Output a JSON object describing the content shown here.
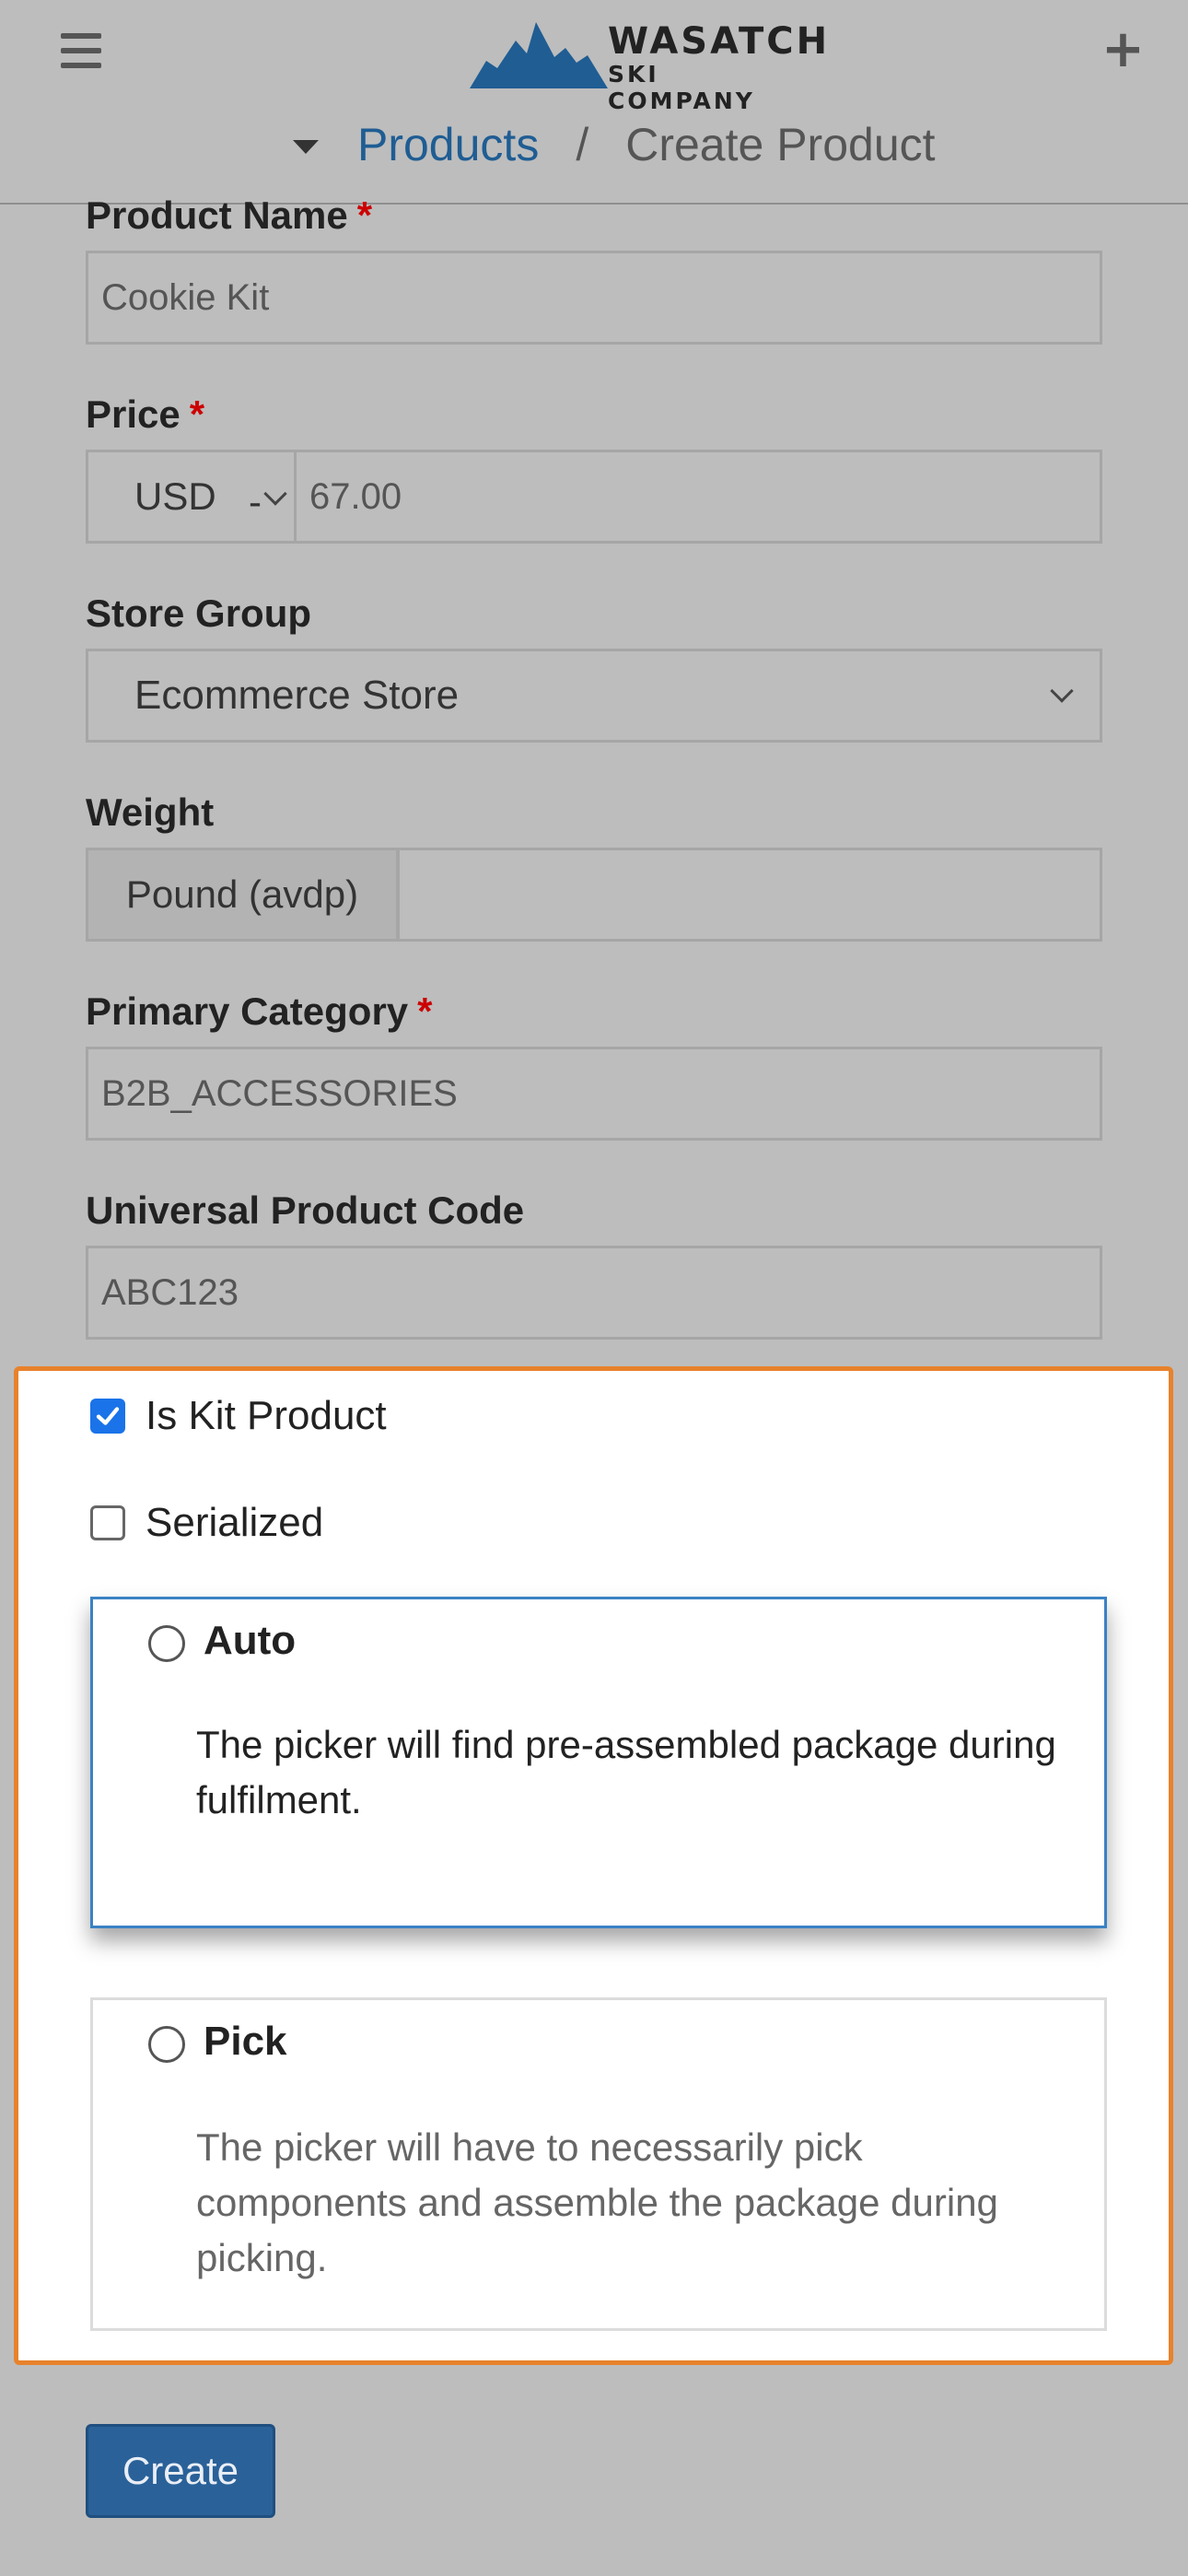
{
  "header": {
    "logo": {
      "line1": "WASATCH",
      "line2": "SKI COMPANY",
      "icon": "mountain-logo-icon"
    },
    "menu_icon": "hamburger-icon",
    "add_icon": "plus-icon",
    "breadcrumb": {
      "link": "Products",
      "separator": "/",
      "current": "Create Product"
    }
  },
  "form": {
    "product_name": {
      "label": "Product Name",
      "required": "*",
      "value": "Cookie Kit"
    },
    "price": {
      "label": "Price",
      "required": "*",
      "currency": "USD",
      "currency_suffix": "-",
      "value": "67.00"
    },
    "store_group": {
      "label": "Store Group",
      "value": "Ecommerce Store"
    },
    "weight": {
      "label": "Weight",
      "unit": "Pound (avdp)",
      "value": ""
    },
    "primary_category": {
      "label": "Primary Category",
      "required": "*",
      "value": "B2B_ACCESSORIES"
    },
    "upc": {
      "label": "Universal Product Code",
      "value": "ABC123"
    }
  },
  "kit_options": {
    "is_kit": {
      "label": "Is Kit Product",
      "checked": true
    },
    "serialized": {
      "label": "Serialized",
      "checked": false
    },
    "auto": {
      "title": "Auto",
      "description": "The picker will find pre-assembled package during fulfilment."
    },
    "pick": {
      "title": "Pick",
      "description": "The picker will have to necessarily pick components and assemble the package during picking."
    }
  },
  "actions": {
    "create_label": "Create"
  },
  "colors": {
    "highlight_border": "#e8822c",
    "primary": "#2a6199",
    "link": "#1f5d93",
    "required": "#cc0000",
    "checkbox": "#1a73e8"
  }
}
